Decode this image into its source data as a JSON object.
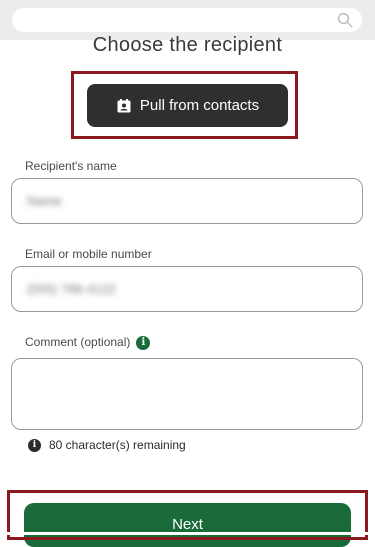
{
  "header": {
    "search_placeholder": ""
  },
  "page": {
    "title": "Choose the recipient"
  },
  "contacts_button": {
    "label": "Pull from contacts"
  },
  "form": {
    "name": {
      "label": "Recipient's name",
      "value": "Name"
    },
    "contact": {
      "label": "Email or mobile number",
      "value": "(555) 786-4122"
    },
    "comment": {
      "label": "Comment (optional)",
      "value": ""
    },
    "remaining_text": "80 character(s) remaining"
  },
  "next_button": {
    "label": "Next"
  },
  "colors": {
    "accent_green": "#1a6b3a",
    "highlight_red": "#8b1a1f",
    "dark_button": "#2f2f2f"
  },
  "icons": {
    "search": "search-icon",
    "contact": "contact-card-icon",
    "info_green": "info-icon",
    "info_dark": "info-icon"
  }
}
